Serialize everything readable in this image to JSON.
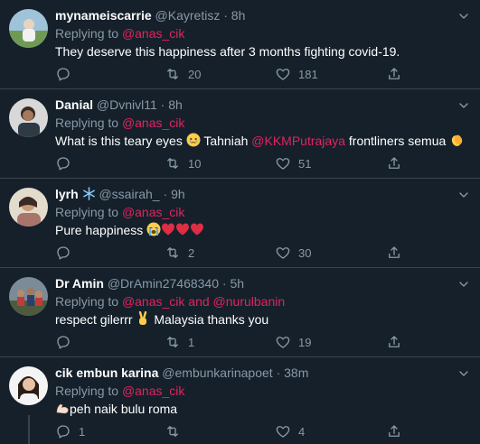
{
  "tweets": [
    {
      "name": "mynameiscarrie",
      "handle": "@Kayretisz",
      "separator": "·",
      "time": "8h",
      "replying_label": "Replying to",
      "replying_to": "@anas_cik",
      "text": "They deserve this happiness after 3 months fighting covid-19.",
      "replies": "",
      "retweets": "20",
      "likes": "181",
      "avatar_icon": "avatar-photo"
    },
    {
      "name": "Danial",
      "handle": "@Dvnivl11",
      "separator": "·",
      "time": "8h",
      "replying_label": "Replying to",
      "replying_to": "@anas_cik",
      "text_before": "What is this teary eyes",
      "text_mid": "Tahniah",
      "mention": "@KKMPutrajaya",
      "text_after": "frontliners semua",
      "replies": "",
      "retweets": "10",
      "likes": "51",
      "emoji_1": "teary-face-emoji",
      "emoji_2": "clap-emoji"
    },
    {
      "name": "lyrh",
      "handle": "@ssairah_",
      "separator": "·",
      "time": "9h",
      "replying_label": "Replying to",
      "replying_to": "@anas_cik",
      "text": "Pure happiness",
      "replies": "",
      "retweets": "2",
      "likes": "30",
      "emoji_1": "snowflake-emoji",
      "emoji_2": "crying-face-emoji",
      "emoji_3": "red-heart-emoji"
    },
    {
      "name": "Dr Amin",
      "handle": "@DrAmin27468340",
      "separator": "·",
      "time": "5h",
      "replying_label": "Replying to",
      "replying_to": "@anas_cik",
      "and_label": "and",
      "replying_to_2": "@nurulbanin",
      "text_before": "respect gilerrr",
      "text_after": "Malaysia thanks you",
      "replies": "",
      "retweets": "1",
      "likes": "19",
      "emoji_1": "victory-hand-emoji"
    },
    {
      "name": "cik embun karina",
      "handle": "@embunkarinapoet",
      "separator": "·",
      "time": "38m",
      "replying_label": "Replying to",
      "replying_to": "@anas_cik",
      "text": "peh naik bulu roma",
      "replies": "1",
      "retweets": "",
      "likes": "4",
      "emoji_1": "flexed-biceps-emoji"
    }
  ],
  "colors": {
    "background": "#15202b",
    "divider": "#38444d",
    "muted": "#8899a6",
    "mention": "#e0245e"
  }
}
